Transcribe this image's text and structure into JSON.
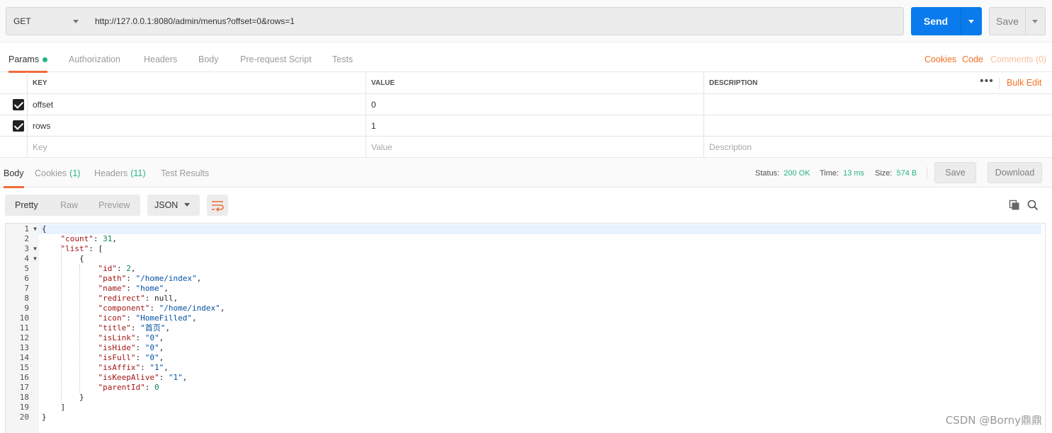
{
  "request": {
    "method": "GET",
    "url": "http://127.0.0.1:8080/admin/menus?offset=0&rows=1",
    "send_label": "Send",
    "save_label": "Save"
  },
  "request_tabs": [
    {
      "label": "Params",
      "active": true
    },
    {
      "label": "Authorization"
    },
    {
      "label": "Headers"
    },
    {
      "label": "Body"
    },
    {
      "label": "Pre-request Script"
    },
    {
      "label": "Tests"
    }
  ],
  "right_links": {
    "cookies": "Cookies",
    "code": "Code",
    "comments": "Comments (0)"
  },
  "params": {
    "headers": {
      "key": "KEY",
      "value": "VALUE",
      "description": "DESCRIPTION"
    },
    "bulk_edit": "Bulk Edit",
    "rows": [
      {
        "checked": true,
        "key": "offset",
        "value": "0"
      },
      {
        "checked": true,
        "key": "rows",
        "value": "1"
      }
    ],
    "placeholders": {
      "key": "Key",
      "value": "Value",
      "description": "Description"
    }
  },
  "response_tabs": {
    "body": "Body",
    "cookies": "Cookies",
    "cookies_count": "(1)",
    "headers": "Headers",
    "headers_count": "(11)",
    "tests": "Test Results"
  },
  "response_meta": {
    "status_label": "Status:",
    "status": "200 OK",
    "time_label": "Time:",
    "time": "13 ms",
    "size_label": "Size:",
    "size": "574 B",
    "save": "Save",
    "download": "Download"
  },
  "viewer": {
    "pretty": "Pretty",
    "raw": "Raw",
    "preview": "Preview",
    "format": "JSON"
  },
  "code_lines": [
    "{",
    "    \"count\": 31,",
    "    \"list\": [",
    "        {",
    "            \"id\": 2,",
    "            \"path\": \"/home/index\",",
    "            \"name\": \"home\",",
    "            \"redirect\": null,",
    "            \"component\": \"/home/index\",",
    "            \"icon\": \"HomeFilled\",",
    "            \"title\": \"首页\",",
    "            \"isLink\": \"0\",",
    "            \"isHide\": \"0\",",
    "            \"isFull\": \"0\",",
    "            \"isAffix\": \"1\",",
    "            \"isKeepAlive\": \"1\",",
    "            \"parentId\": 0",
    "        }",
    "    ]",
    "}"
  ],
  "fold_lines": [
    1,
    3,
    4
  ],
  "watermark": "CSDN @Borny鼎鼎"
}
